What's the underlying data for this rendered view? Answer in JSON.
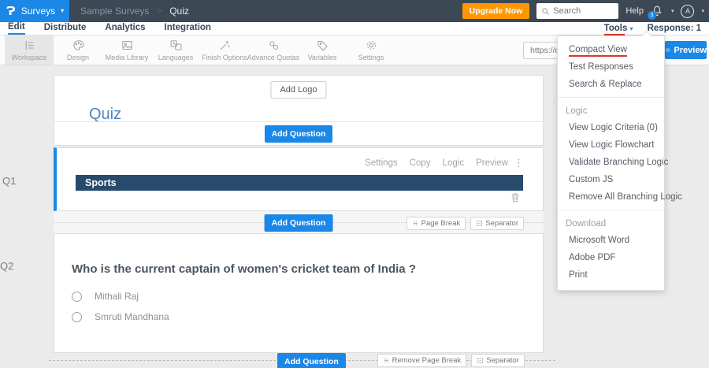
{
  "colors": {
    "accent": "#1b87e6",
    "upgrade_orange": "#ff9800",
    "question_header_bg": "#274a6d",
    "annotation_red": "#e0342f",
    "topbar_bg": "#3c4853"
  },
  "brand": {
    "logo_glyph": "Ɂ",
    "product": "Surveys",
    "caret": "▾"
  },
  "header": {
    "breadcrumb_parent": "Sample Surveys",
    "breadcrumb_sep": ">",
    "breadcrumb_current": "Quiz",
    "upgrade_label": "Upgrade Now",
    "search_placeholder": "Search",
    "help_label": "Help",
    "notification_count": "3",
    "avatar_initial": "A",
    "caret": "▾"
  },
  "tabs": {
    "items": [
      {
        "label": "Edit"
      },
      {
        "label": "Distribute"
      },
      {
        "label": "Analytics"
      },
      {
        "label": "Integration"
      }
    ],
    "active": "Edit",
    "tools_label": "Tools",
    "tools_caret": "▾",
    "response_label": "Response: 1"
  },
  "toolbar": {
    "items": [
      {
        "label": "Workspace"
      },
      {
        "label": "Design"
      },
      {
        "label": "Media Library"
      },
      {
        "label": "Languages"
      },
      {
        "label": "Finish Options"
      },
      {
        "label": "Advance Quotas"
      },
      {
        "label": "Variables"
      },
      {
        "label": "Settings"
      }
    ],
    "selected": "Workspace",
    "url_value": "https://q",
    "preview_label": "Preview"
  },
  "menu": {
    "groups": [
      {
        "items": [
          {
            "label": "Compact View"
          },
          {
            "label": "Test Responses"
          },
          {
            "label": "Search & Replace"
          }
        ]
      },
      {
        "header": "Logic",
        "items": [
          {
            "label": "View Logic Criteria (0)"
          },
          {
            "label": "View Logic Flowchart"
          },
          {
            "label": "Validate Branching Logic"
          },
          {
            "label": "Custom JS"
          },
          {
            "label": "Remove All Branching Logic"
          }
        ]
      },
      {
        "header": "Download",
        "items": [
          {
            "label": "Microsoft Word"
          },
          {
            "label": "Adobe PDF"
          },
          {
            "label": "Print"
          }
        ]
      }
    ],
    "highlighted": "Compact View"
  },
  "survey": {
    "add_logo_label": "Add Logo",
    "title": "Quiz",
    "add_question_label": "Add Question",
    "q1": {
      "id": "Q1",
      "actions": [
        {
          "label": "Settings"
        },
        {
          "label": "Copy"
        },
        {
          "label": "Logic"
        },
        {
          "label": "Preview"
        }
      ],
      "kebab": "⋮",
      "block_title": "Sports"
    },
    "between": {
      "page_break_label": "Page Break",
      "separator_label": "Separator"
    },
    "q2": {
      "id": "Q2",
      "question": "Who is the current captain of women's cricket team of India ?",
      "options": [
        {
          "label": "Mithali Raj"
        },
        {
          "label": "Smruti Mandhana"
        }
      ]
    },
    "bottom": {
      "remove_page_break_label": "Remove Page Break",
      "separator_label": "Separator"
    }
  }
}
